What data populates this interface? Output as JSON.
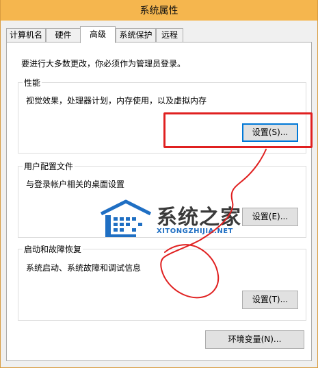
{
  "window": {
    "title": "系统属性"
  },
  "tabs": [
    {
      "label": "计算机名",
      "active": false
    },
    {
      "label": "硬件",
      "active": false
    },
    {
      "label": "高级",
      "active": true
    },
    {
      "label": "系统保护",
      "active": false
    },
    {
      "label": "远程",
      "active": false
    }
  ],
  "advanced": {
    "admin_note": "要进行大多数更改，你必须作为管理员登录。",
    "performance": {
      "title": "性能",
      "description": "视觉效果，处理器计划，内存使用，以及虚拟内存",
      "settings_button": "设置(S)..."
    },
    "user_profiles": {
      "title": "用户配置文件",
      "description": "与登录帐户相关的桌面设置",
      "settings_button": "设置(E)..."
    },
    "startup_recovery": {
      "title": "启动和故障恢复",
      "description": "系统启动、系统故障和调试信息",
      "settings_button": "设置(T)..."
    },
    "env_vars_button": "环境变量(N)..."
  },
  "watermark": {
    "name": "系统之家",
    "url": "XITONGZHIJIA.NET"
  },
  "colors": {
    "titlebar": "#f5b64e",
    "annotation_red": "#e02020",
    "focus_blue": "#0078d7",
    "watermark_blue": "#1f6fc3"
  }
}
